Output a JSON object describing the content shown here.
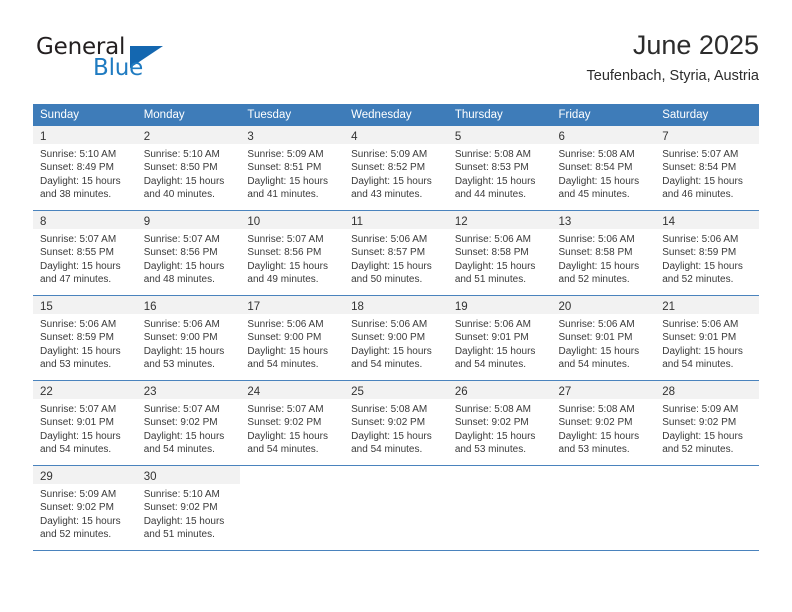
{
  "logo": {
    "word1": "General",
    "word2": "Blue",
    "triangle_color": "#1467b0",
    "blue_color": "#1f7bc1",
    "dark_color": "#231f20"
  },
  "header": {
    "title": "June 2025",
    "subtitle": "Teufenbach, Styria, Austria"
  },
  "colors": {
    "header_row": "#3e7cb9",
    "daynum_strip": "#f2f2f2",
    "row_divider": "#4a83bd",
    "text": "#3a3a3a"
  },
  "weekday_headers": [
    "Sunday",
    "Monday",
    "Tuesday",
    "Wednesday",
    "Thursday",
    "Friday",
    "Saturday"
  ],
  "weeks": [
    [
      {
        "day": "1",
        "sunrise": "Sunrise: 5:10 AM",
        "sunset": "Sunset: 8:49 PM",
        "daylight1": "Daylight: 15 hours",
        "daylight2": "and 38 minutes."
      },
      {
        "day": "2",
        "sunrise": "Sunrise: 5:10 AM",
        "sunset": "Sunset: 8:50 PM",
        "daylight1": "Daylight: 15 hours",
        "daylight2": "and 40 minutes."
      },
      {
        "day": "3",
        "sunrise": "Sunrise: 5:09 AM",
        "sunset": "Sunset: 8:51 PM",
        "daylight1": "Daylight: 15 hours",
        "daylight2": "and 41 minutes."
      },
      {
        "day": "4",
        "sunrise": "Sunrise: 5:09 AM",
        "sunset": "Sunset: 8:52 PM",
        "daylight1": "Daylight: 15 hours",
        "daylight2": "and 43 minutes."
      },
      {
        "day": "5",
        "sunrise": "Sunrise: 5:08 AM",
        "sunset": "Sunset: 8:53 PM",
        "daylight1": "Daylight: 15 hours",
        "daylight2": "and 44 minutes."
      },
      {
        "day": "6",
        "sunrise": "Sunrise: 5:08 AM",
        "sunset": "Sunset: 8:54 PM",
        "daylight1": "Daylight: 15 hours",
        "daylight2": "and 45 minutes."
      },
      {
        "day": "7",
        "sunrise": "Sunrise: 5:07 AM",
        "sunset": "Sunset: 8:54 PM",
        "daylight1": "Daylight: 15 hours",
        "daylight2": "and 46 minutes."
      }
    ],
    [
      {
        "day": "8",
        "sunrise": "Sunrise: 5:07 AM",
        "sunset": "Sunset: 8:55 PM",
        "daylight1": "Daylight: 15 hours",
        "daylight2": "and 47 minutes."
      },
      {
        "day": "9",
        "sunrise": "Sunrise: 5:07 AM",
        "sunset": "Sunset: 8:56 PM",
        "daylight1": "Daylight: 15 hours",
        "daylight2": "and 48 minutes."
      },
      {
        "day": "10",
        "sunrise": "Sunrise: 5:07 AM",
        "sunset": "Sunset: 8:56 PM",
        "daylight1": "Daylight: 15 hours",
        "daylight2": "and 49 minutes."
      },
      {
        "day": "11",
        "sunrise": "Sunrise: 5:06 AM",
        "sunset": "Sunset: 8:57 PM",
        "daylight1": "Daylight: 15 hours",
        "daylight2": "and 50 minutes."
      },
      {
        "day": "12",
        "sunrise": "Sunrise: 5:06 AM",
        "sunset": "Sunset: 8:58 PM",
        "daylight1": "Daylight: 15 hours",
        "daylight2": "and 51 minutes."
      },
      {
        "day": "13",
        "sunrise": "Sunrise: 5:06 AM",
        "sunset": "Sunset: 8:58 PM",
        "daylight1": "Daylight: 15 hours",
        "daylight2": "and 52 minutes."
      },
      {
        "day": "14",
        "sunrise": "Sunrise: 5:06 AM",
        "sunset": "Sunset: 8:59 PM",
        "daylight1": "Daylight: 15 hours",
        "daylight2": "and 52 minutes."
      }
    ],
    [
      {
        "day": "15",
        "sunrise": "Sunrise: 5:06 AM",
        "sunset": "Sunset: 8:59 PM",
        "daylight1": "Daylight: 15 hours",
        "daylight2": "and 53 minutes."
      },
      {
        "day": "16",
        "sunrise": "Sunrise: 5:06 AM",
        "sunset": "Sunset: 9:00 PM",
        "daylight1": "Daylight: 15 hours",
        "daylight2": "and 53 minutes."
      },
      {
        "day": "17",
        "sunrise": "Sunrise: 5:06 AM",
        "sunset": "Sunset: 9:00 PM",
        "daylight1": "Daylight: 15 hours",
        "daylight2": "and 54 minutes."
      },
      {
        "day": "18",
        "sunrise": "Sunrise: 5:06 AM",
        "sunset": "Sunset: 9:00 PM",
        "daylight1": "Daylight: 15 hours",
        "daylight2": "and 54 minutes."
      },
      {
        "day": "19",
        "sunrise": "Sunrise: 5:06 AM",
        "sunset": "Sunset: 9:01 PM",
        "daylight1": "Daylight: 15 hours",
        "daylight2": "and 54 minutes."
      },
      {
        "day": "20",
        "sunrise": "Sunrise: 5:06 AM",
        "sunset": "Sunset: 9:01 PM",
        "daylight1": "Daylight: 15 hours",
        "daylight2": "and 54 minutes."
      },
      {
        "day": "21",
        "sunrise": "Sunrise: 5:06 AM",
        "sunset": "Sunset: 9:01 PM",
        "daylight1": "Daylight: 15 hours",
        "daylight2": "and 54 minutes."
      }
    ],
    [
      {
        "day": "22",
        "sunrise": "Sunrise: 5:07 AM",
        "sunset": "Sunset: 9:01 PM",
        "daylight1": "Daylight: 15 hours",
        "daylight2": "and 54 minutes."
      },
      {
        "day": "23",
        "sunrise": "Sunrise: 5:07 AM",
        "sunset": "Sunset: 9:02 PM",
        "daylight1": "Daylight: 15 hours",
        "daylight2": "and 54 minutes."
      },
      {
        "day": "24",
        "sunrise": "Sunrise: 5:07 AM",
        "sunset": "Sunset: 9:02 PM",
        "daylight1": "Daylight: 15 hours",
        "daylight2": "and 54 minutes."
      },
      {
        "day": "25",
        "sunrise": "Sunrise: 5:08 AM",
        "sunset": "Sunset: 9:02 PM",
        "daylight1": "Daylight: 15 hours",
        "daylight2": "and 54 minutes."
      },
      {
        "day": "26",
        "sunrise": "Sunrise: 5:08 AM",
        "sunset": "Sunset: 9:02 PM",
        "daylight1": "Daylight: 15 hours",
        "daylight2": "and 53 minutes."
      },
      {
        "day": "27",
        "sunrise": "Sunrise: 5:08 AM",
        "sunset": "Sunset: 9:02 PM",
        "daylight1": "Daylight: 15 hours",
        "daylight2": "and 53 minutes."
      },
      {
        "day": "28",
        "sunrise": "Sunrise: 5:09 AM",
        "sunset": "Sunset: 9:02 PM",
        "daylight1": "Daylight: 15 hours",
        "daylight2": "and 52 minutes."
      }
    ],
    [
      {
        "day": "29",
        "sunrise": "Sunrise: 5:09 AM",
        "sunset": "Sunset: 9:02 PM",
        "daylight1": "Daylight: 15 hours",
        "daylight2": "and 52 minutes."
      },
      {
        "day": "30",
        "sunrise": "Sunrise: 5:10 AM",
        "sunset": "Sunset: 9:02 PM",
        "daylight1": "Daylight: 15 hours",
        "daylight2": "and 51 minutes."
      },
      {
        "day": "",
        "sunrise": "",
        "sunset": "",
        "daylight1": "",
        "daylight2": ""
      },
      {
        "day": "",
        "sunrise": "",
        "sunset": "",
        "daylight1": "",
        "daylight2": ""
      },
      {
        "day": "",
        "sunrise": "",
        "sunset": "",
        "daylight1": "",
        "daylight2": ""
      },
      {
        "day": "",
        "sunrise": "",
        "sunset": "",
        "daylight1": "",
        "daylight2": ""
      },
      {
        "day": "",
        "sunrise": "",
        "sunset": "",
        "daylight1": "",
        "daylight2": ""
      }
    ]
  ]
}
